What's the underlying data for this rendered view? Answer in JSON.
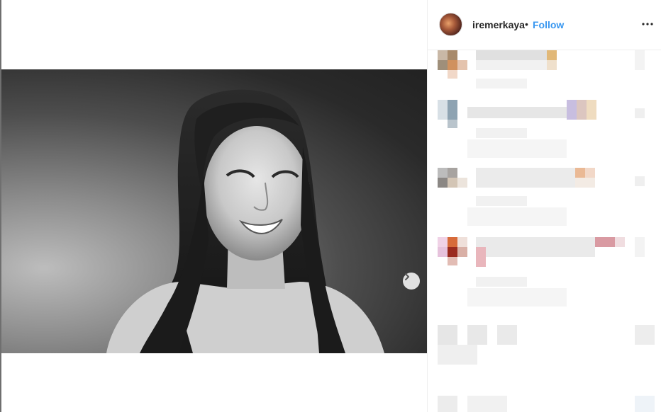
{
  "post": {
    "username": "iremerkaya",
    "separator": "•",
    "follow_label": "Follow",
    "more_glyph": "•••",
    "next_glyph": "›"
  },
  "icons": {
    "avatar": "profile-avatar",
    "next": "chevron-right-icon",
    "more": "more-options-icon"
  },
  "colors": {
    "follow": "#3897f0",
    "text": "#262626",
    "divider": "#efefef"
  },
  "comments": [
    {
      "blurred": true
    },
    {
      "blurred": true
    },
    {
      "blurred": true
    },
    {
      "blurred": true
    },
    {
      "blurred": true
    },
    {
      "blurred": true
    }
  ]
}
